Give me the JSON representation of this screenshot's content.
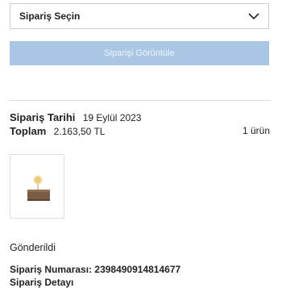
{
  "order_select": {
    "label": "Sipariş Seçin",
    "icon": "chevron-down-icon"
  },
  "view_button": {
    "label": "Siparişi Görüntüle",
    "bg_color": "#a9c7e4"
  },
  "order": {
    "date_label": "Sipariş Tarihi",
    "date_value": "19 Eylül 2023",
    "total_label": "Toplam",
    "total_value": "2.163,50 TL",
    "item_count": "1 ürün",
    "status": "Gönderildi",
    "number_label": "Sipariş Numarası:",
    "number_value": "2398490914814677",
    "detail_label": "Sipariş Detayı"
  },
  "product": {
    "image": "product-thumbnail"
  }
}
